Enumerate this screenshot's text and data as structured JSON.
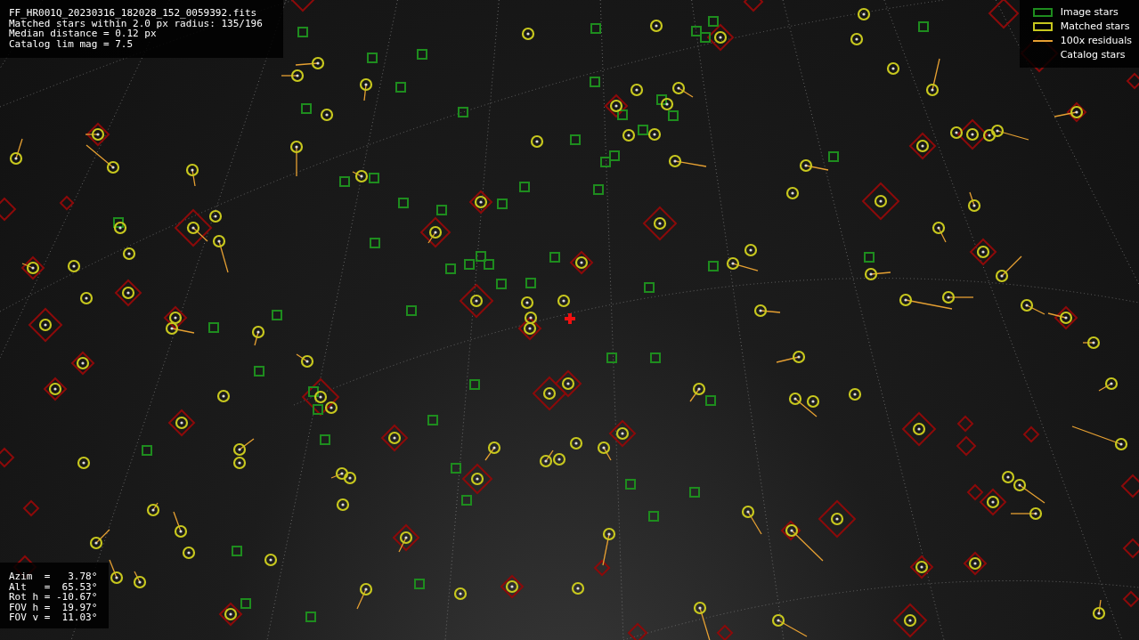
{
  "info_lines": [
    "FF_HR001Q_20230316_182028_152_0059392.fits",
    "Matched stars within 2.0 px radius: 135/196",
    "Median distance = 0.12 px",
    "Catalog lim mag = 7.5"
  ],
  "legend": [
    {
      "kind": "box",
      "label": "Image stars",
      "color": "#1e8c1e"
    },
    {
      "kind": "box",
      "label": "Matched stars",
      "color": "#c8c81e"
    },
    {
      "kind": "line",
      "label": "100x residuals",
      "color": "#e6a032"
    },
    {
      "kind": "blank",
      "label": "Catalog stars"
    }
  ],
  "pointing_lines": [
    "Azim  =   3.78°",
    "Alt   =  65.53°",
    "Rot h = -10.67°",
    "FOV h =  19.97°",
    "FOV v =  11.03°"
  ]
}
